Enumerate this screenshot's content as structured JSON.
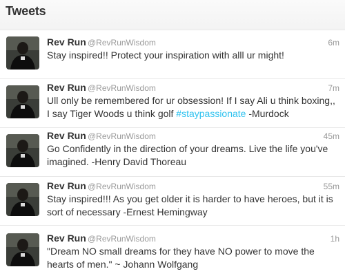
{
  "header": {
    "title": "Tweets"
  },
  "tweets": [
    {
      "name": "Rev Run",
      "handle": "@RevRunWisdom",
      "time": "6m",
      "text": "Stay inspired!! Protect your inspiration with alll ur might!"
    },
    {
      "name": "Rev Run",
      "handle": "@RevRunWisdom",
      "time": "7m",
      "text_before": "Ull only be remembered for ur obsession! If I say Ali u think boxing,, I say Tiger Woods u think golf ",
      "hashtag": "#staypassionate",
      "text_after": " -Murdock"
    },
    {
      "name": "Rev Run",
      "handle": "@RevRunWisdom",
      "time": "45m",
      "text": "Go Confidently in the direction of your dreams. Live the life you've imagined. -Henry David Thoreau"
    },
    {
      "name": "Rev Run",
      "handle": "@RevRunWisdom",
      "time": "55m",
      "text": "Stay inspired!!! As you get older it is harder to have heroes, but it is sort of necessary -Ernest Hemingway"
    },
    {
      "name": "Rev Run",
      "handle": "@RevRunWisdom",
      "time": "1h",
      "text": "\"Dream NO small dreams for they have NO power to move the hearts of men.\" ~ Johann Wolfgang"
    }
  ],
  "colors": {
    "hashtag": "#2fc2ef",
    "muted": "#999999",
    "text": "#333333"
  },
  "icons": {
    "avatar": "rev-run-avatar-icon"
  }
}
